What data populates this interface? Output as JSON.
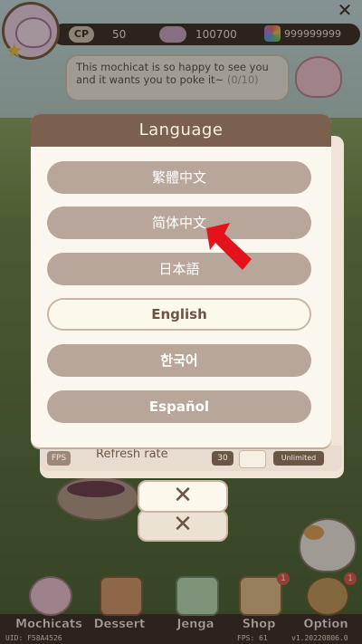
{
  "top": {
    "cp_label": "CP",
    "cp_value": "50",
    "mochi_value": "100700",
    "gem_value": "999999999"
  },
  "bubble": {
    "message": "This mochicat is so happy to see you and it wants you to poke it~",
    "progress": "(0/10)"
  },
  "language_dialog": {
    "title": "Language",
    "options": [
      {
        "label": "繁體中文",
        "selected": false
      },
      {
        "label": "简体中文",
        "selected": false
      },
      {
        "label": "日本語",
        "selected": false
      },
      {
        "label": "English",
        "selected": true
      },
      {
        "label": "한국어",
        "selected": false
      },
      {
        "label": "Español",
        "selected": false
      }
    ]
  },
  "settings_row": {
    "tag": "FPS",
    "label": "Refresh rate",
    "value": "30",
    "option": "Unlimited"
  },
  "close_label": "✕",
  "nav": {
    "items": [
      {
        "label": "Mochicats",
        "icon": "mochicat-icon",
        "badge": ""
      },
      {
        "label": "Dessert",
        "icon": "cake-icon",
        "badge": ""
      },
      {
        "label": "Jenga",
        "icon": "jenga-icon",
        "badge": ""
      },
      {
        "label": "Shop",
        "icon": "shop-icon",
        "badge": "1"
      },
      {
        "label": "Option",
        "icon": "gear-icon",
        "badge": "1"
      }
    ]
  },
  "footer": {
    "uid": "UID: F58A4526",
    "fps": "FPS: 61",
    "version": "v1.20220806.0"
  },
  "colors": {
    "header": "#7b614d",
    "button": "#b8a69a",
    "selected_button": "#fdf8ec",
    "arrow": "#e3121b"
  }
}
